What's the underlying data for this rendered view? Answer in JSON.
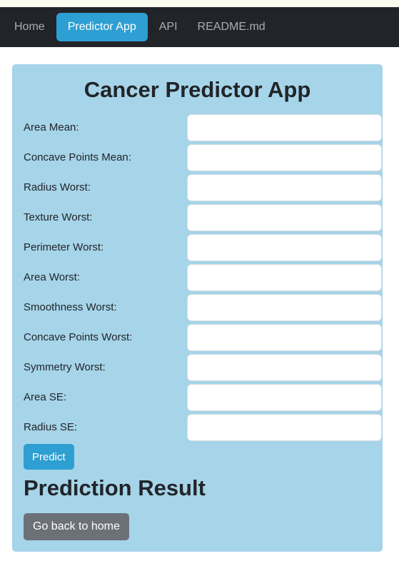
{
  "nav": {
    "items": [
      {
        "label": "Home",
        "active": false
      },
      {
        "label": "Predictor App",
        "active": true
      },
      {
        "label": "API",
        "active": false
      },
      {
        "label": "README.md",
        "active": false
      }
    ]
  },
  "main": {
    "title": "Cancer Predictor App",
    "fields": [
      {
        "label": "Area Mean:",
        "value": ""
      },
      {
        "label": "Concave Points Mean:",
        "value": ""
      },
      {
        "label": "Radius Worst:",
        "value": ""
      },
      {
        "label": "Texture Worst:",
        "value": ""
      },
      {
        "label": "Perimeter Worst:",
        "value": ""
      },
      {
        "label": "Area Worst:",
        "value": ""
      },
      {
        "label": "Smoothness Worst:",
        "value": ""
      },
      {
        "label": "Concave Points Worst:",
        "value": ""
      },
      {
        "label": "Symmetry Worst:",
        "value": ""
      },
      {
        "label": "Area SE:",
        "value": ""
      },
      {
        "label": "Radius SE:",
        "value": ""
      }
    ],
    "predict_label": "Predict",
    "result_heading": "Prediction Result",
    "back_label": "Go back to home"
  },
  "colors": {
    "navbar_bg": "#212529",
    "nav_active_bg": "#2d9fd3",
    "panel_bg": "#a6d4e9",
    "predict_button": "#2d9fd3",
    "back_button": "#6c7178"
  }
}
